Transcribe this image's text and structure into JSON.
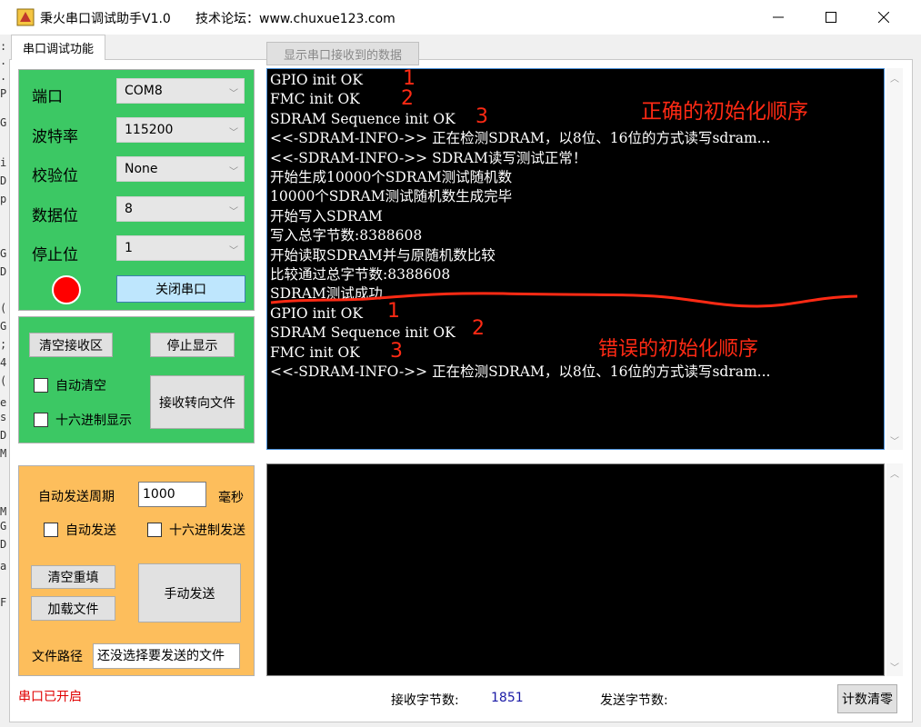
{
  "window": {
    "title": "秉火串口调试助手V1.0",
    "forum": "技术论坛：www.chuxue123.com",
    "minimize_icon": "minimize-icon",
    "maximize_icon": "maximize-icon",
    "close_icon": "close-icon"
  },
  "edge_fragments": [
    ":",
    ".",
    ".",
    "P",
    "G",
    "i",
    "D",
    "p",
    "G",
    "D",
    "(",
    "G",
    ";",
    "4",
    "(",
    "e",
    "s",
    "D",
    "M",
    "M",
    "G",
    "D",
    "a",
    "F"
  ],
  "tabs": {
    "main": "串口调试功能"
  },
  "serial": {
    "port_label": "端口",
    "port_value": "COM8",
    "baud_label": "波特率",
    "baud_value": "115200",
    "parity_label": "校验位",
    "parity_value": "None",
    "databits_label": "数据位",
    "databits_value": "8",
    "stopbits_label": "停止位",
    "stopbits_value": "1",
    "toggle_label": "关闭串口",
    "status_color": "#ff0000"
  },
  "rx_panel": {
    "clear_label": "清空接收区",
    "stop_label": "停止显示",
    "auto_clear_label": "自动清空",
    "hex_display_label": "十六进制显示",
    "redirect_label": "接收转向文件"
  },
  "tx_panel": {
    "period_label": "自动发送周期",
    "period_value": "1000",
    "ms_label": "毫秒",
    "auto_send_label": "自动发送",
    "hex_send_label": "十六进制发送",
    "clear_resend_label": "清空重填",
    "load_file_label": "加载文件",
    "manual_send_label": "手动发送",
    "file_path_label": "文件路径",
    "file_path_value": "还没选择要发送的文件"
  },
  "rx_float_button": "显示串口接收到的数据",
  "receive_lines": [
    "GPIO init OK",
    "FMC init OK",
    "SDRAM Sequence init OK",
    "<<-SDRAM-INFO->> 正在检测SDRAM，以8位、16位的方式读写sdram...",
    "<<-SDRAM-INFO->> SDRAM读写测试正常！",
    "开始生成10000个SDRAM测试随机数",
    "10000个SDRAM测试随机数生成完毕",
    "开始写入SDRAM",
    "写入总字节数:8388608",
    "开始读取SDRAM并与原随机数比较",
    "比较通过总字节数:8388608",
    "SDRAM测试成功",
    "GPIO init OK",
    "SDRAM Sequence init OK",
    "FMC init OK",
    "<<-SDRAM-INFO->> 正在检测SDRAM，以8位、16位的方式读写sdram..."
  ],
  "annotations": {
    "correct_order": "正确的初始化顺序",
    "wrong_order": "错误的初始化顺序",
    "numbers_top": [
      "1",
      "2",
      "3"
    ],
    "numbers_bottom": [
      "1",
      "2",
      "3"
    ],
    "color": "#ff2a14"
  },
  "status_bar": {
    "port_status": "串口已开启",
    "rx_count_label": "接收字节数:",
    "rx_count_value": "1851",
    "tx_count_label": "发送字节数:",
    "reset_label": "计数清零"
  },
  "colors": {
    "serial_group": "#3cc864",
    "tx_group": "#fdbe5c",
    "terminal_bg": "#000000"
  }
}
